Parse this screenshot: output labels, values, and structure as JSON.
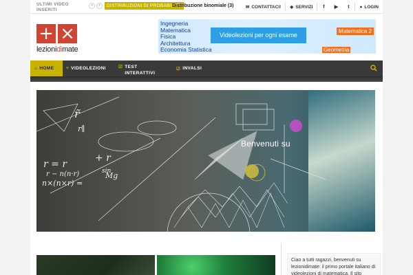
{
  "topbar": {
    "recent_label": "ULTIMI VIDEO INSERITI",
    "prev_icon": "chevron-left-icon",
    "next_icon": "chevron-right-icon",
    "category": "DISTRIBUZIONI DI PROBABILITÀ",
    "ticker_title": "Distribuzione binomiale (3)",
    "contact_label": "CONTATTACI!",
    "services_label": "SERVIZI",
    "social": [
      "facebook-icon",
      "youtube-icon",
      "twitter-icon"
    ],
    "social_glyphs": [
      "f",
      "▶",
      "t"
    ],
    "login_label": "LOGIN"
  },
  "logo": {
    "plus": "+",
    "times": "×",
    "text_a": "lezioni",
    "text_b": "di",
    "text_c": "mate"
  },
  "banner": {
    "subjects": [
      "Ingegneria",
      "Matematica",
      "Fisica",
      "Architettura",
      "Economia Statistica"
    ],
    "cta": "Videolezioni per ogni esame",
    "tag1": "Matematica 2",
    "tag2": "Geometria"
  },
  "nav": {
    "items": [
      {
        "label": "HOME",
        "icon": "home-icon",
        "glyph": "⌂",
        "active": true
      },
      {
        "label": "VIDEOLEZIONI",
        "icon": "menu-icon",
        "glyph": "≡"
      },
      {
        "label": "TEST INTERATTIVI",
        "icon": "checkbox-icon",
        "glyph": "☑"
      },
      {
        "label": "INVALSI",
        "icon": "checkbox-icon",
        "glyph": "☑"
      }
    ],
    "search_icon": "search-icon"
  },
  "hero": {
    "caption": "Benvenuti su"
  },
  "sidebar": {
    "intro": "Ciao a tutti ragazzi, benvenuti su lezionidimate: il primo portale italiano di videolezioni di matematica. Il sito"
  },
  "colors": {
    "accent": "#c8b400",
    "logo_red": "#d04433",
    "nav_bg": "#3a3a3a",
    "banner_blue": "#2e9fe6",
    "banner_orange": "#f07020"
  }
}
